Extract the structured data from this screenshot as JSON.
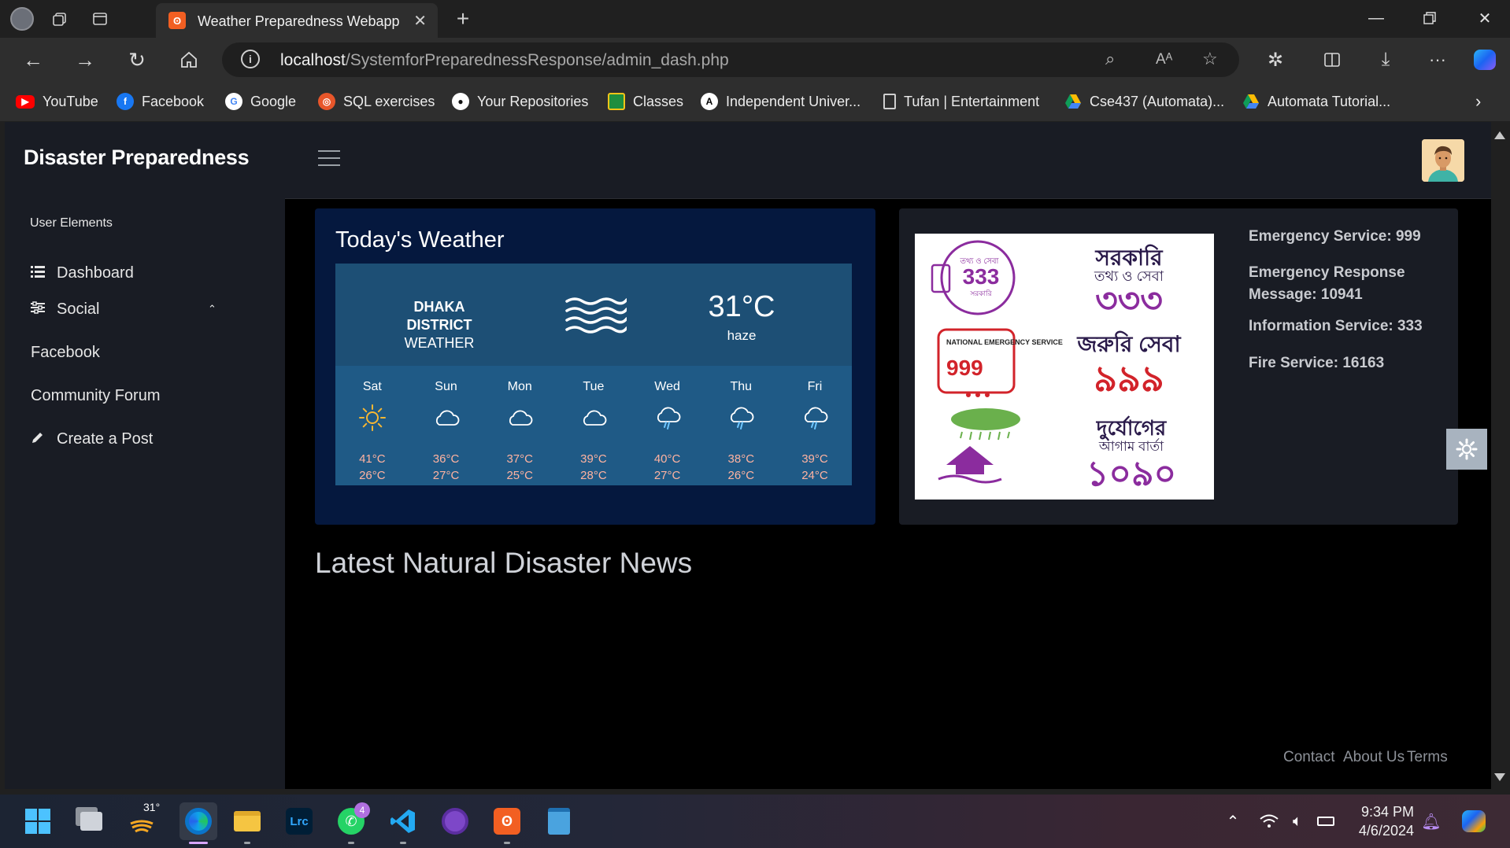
{
  "browser": {
    "tab_title": "Weather Preparedness Webapp",
    "url_host": "localhost",
    "url_path": "/SystemforPreparednessResponse/admin_dash.php",
    "bookmarks": [
      {
        "label": "YouTube",
        "icon": "youtube-icon",
        "color": "#ff0000"
      },
      {
        "label": "Facebook",
        "icon": "facebook-icon",
        "color": "#1877f2"
      },
      {
        "label": "Google",
        "icon": "google-icon",
        "color": "#ffffff"
      },
      {
        "label": "SQL exercises",
        "icon": "sql-icon",
        "color": "#e8562a"
      },
      {
        "label": "Your Repositories",
        "icon": "github-icon",
        "color": "#ffffff"
      },
      {
        "label": "Classes",
        "icon": "classroom-icon",
        "color": "#1e8e3e"
      },
      {
        "label": "Independent Univer...",
        "icon": "university-icon",
        "color": "#000000"
      },
      {
        "label": "Tufan | Entertainment",
        "icon": "page-icon",
        "color": "#cfcfcf"
      },
      {
        "label": "Cse437 (Automata)...",
        "icon": "drive-icon",
        "color": "#fbbc04"
      },
      {
        "label": "Automata Tutorial...",
        "icon": "drive-icon",
        "color": "#fbbc04"
      }
    ]
  },
  "sidebar": {
    "brand": "Disaster Preparedness",
    "category": "User Elements",
    "items": [
      {
        "label": "Dashboard",
        "icon": "list-icon"
      },
      {
        "label": "Social",
        "icon": "sliders-icon",
        "chevron": "⌃"
      },
      {
        "label": "Facebook"
      },
      {
        "label": "Community Forum"
      },
      {
        "label": "Create a Post",
        "icon": "pencil-icon"
      }
    ]
  },
  "weather": {
    "title": "Today's Weather",
    "district_line1": "DHAKA DISTRICT",
    "district_line2": "WEATHER",
    "current_temp": "31°C",
    "condition": "haze",
    "days": [
      {
        "day": "Sat",
        "icon": "sun",
        "high": "41°C",
        "low": "26°C"
      },
      {
        "day": "Sun",
        "icon": "cloud",
        "high": "36°C",
        "low": "27°C"
      },
      {
        "day": "Mon",
        "icon": "cloud",
        "high": "37°C",
        "low": "25°C"
      },
      {
        "day": "Tue",
        "icon": "cloud",
        "high": "39°C",
        "low": "28°C"
      },
      {
        "day": "Wed",
        "icon": "rain",
        "high": "40°C",
        "low": "27°C"
      },
      {
        "day": "Thu",
        "icon": "rain",
        "high": "38°C",
        "low": "26°C"
      },
      {
        "day": "Fri",
        "icon": "rain",
        "high": "39°C",
        "low": "24°C"
      }
    ]
  },
  "emergency": {
    "image": {
      "badge1_top": "তথ্য ও সেবা",
      "badge1_num": "333",
      "badge1_bottom": "সরকারি",
      "big1_title": "সরকারি",
      "big1_sub": "তথ্য ও সেবা",
      "big1_num": "৩৩৩",
      "badge2_text": "NATIONAL EMERGENCY SERVICE",
      "badge2_num": "999",
      "big2_title": "জরুরি সেবা",
      "big2_num": "৯৯৯",
      "big3_title": "দুর্যোগের",
      "big3_sub": "আগাম বার্তা",
      "big3_num": "১০৯০"
    },
    "lines": [
      "Emergency Service: 999",
      "Emergency Response Message: 10941",
      "Information Service: 333",
      "Fire Service: 16163"
    ]
  },
  "news": {
    "title": "Latest Natural Disaster News"
  },
  "footer": {
    "links": [
      "Contact",
      "About Us",
      "Terms"
    ]
  },
  "taskbar": {
    "weather_temp": "31°",
    "whatsapp_badge": "4",
    "lrc_label": "Lrc",
    "time": "9:34 PM",
    "date": "4/6/2024"
  },
  "colors": {
    "page_bg": "#000000",
    "sidebar_bg": "#191c24",
    "weather_card": "#05183e",
    "weather_panel": "#1e4e73",
    "temp_text": "#ffb3a1",
    "purple": "#8b2c9e",
    "red": "#d2232a"
  }
}
